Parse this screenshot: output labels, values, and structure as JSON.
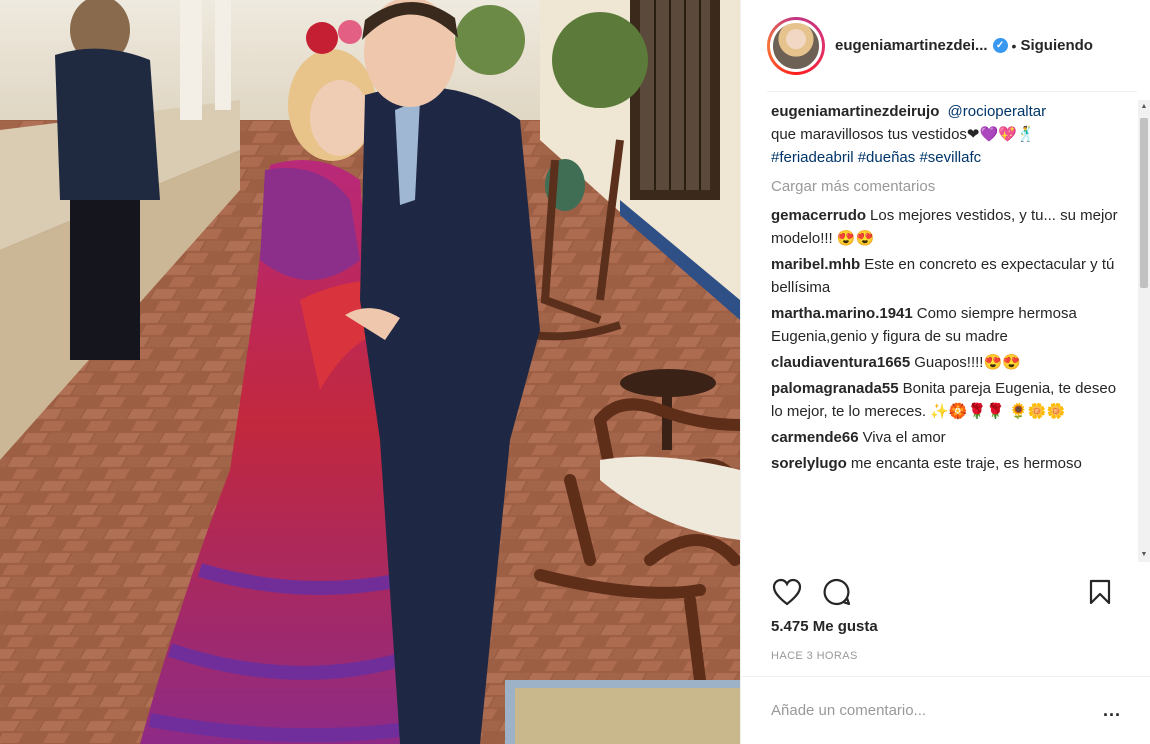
{
  "post": {
    "author": "eugeniamartinezdei...",
    "verified": true,
    "separator": "•",
    "following_label": "Siguiendo",
    "photo_alt": "Foto de la publicación"
  },
  "caption": {
    "user": "eugeniamartinezdeirujo",
    "mention": "@rocioperaltar",
    "text": "que maravillosos tus vestidos❤💜💖🕺",
    "tags": "#feriadeabril #dueñas #sevillafc"
  },
  "load_more": "Cargar más comentarios",
  "comments": [
    {
      "user": "gemacerrudo",
      "text": "Los mejores vestidos, y tu... su mejor modelo!!! 😍😍"
    },
    {
      "user": "maribel.mhb",
      "text": "Este en concreto es expectacular y tú bellísima"
    },
    {
      "user": "martha.marino.1941",
      "text": "Como siempre hermosa Eugenia,genio y figura de su madre"
    },
    {
      "user": "claudiaventura1665",
      "text": "Guapos!!!!😍😍"
    },
    {
      "user": "palomagranada55",
      "text": "Bonita pareja Eugenia, te deseo lo mejor, te lo mereces. ✨🏵️🌹🌹 🌻🌼🌼"
    },
    {
      "user": "carmende66",
      "text": "Viva el amor"
    },
    {
      "user": "sorelylugo",
      "text": "me encanta este traje, es hermoso"
    }
  ],
  "actions": {
    "like_icon": "heart-icon",
    "comment_icon": "comment-icon",
    "save_icon": "bookmark-icon"
  },
  "likes": "5.475 Me gusta",
  "timestamp": "HACE 3 HORAS",
  "composer": {
    "placeholder": "Añade un comentario...",
    "more": "..."
  },
  "colors": {
    "link": "#003569",
    "muted": "#999999",
    "verified": "#3897f0",
    "text": "#262626"
  }
}
